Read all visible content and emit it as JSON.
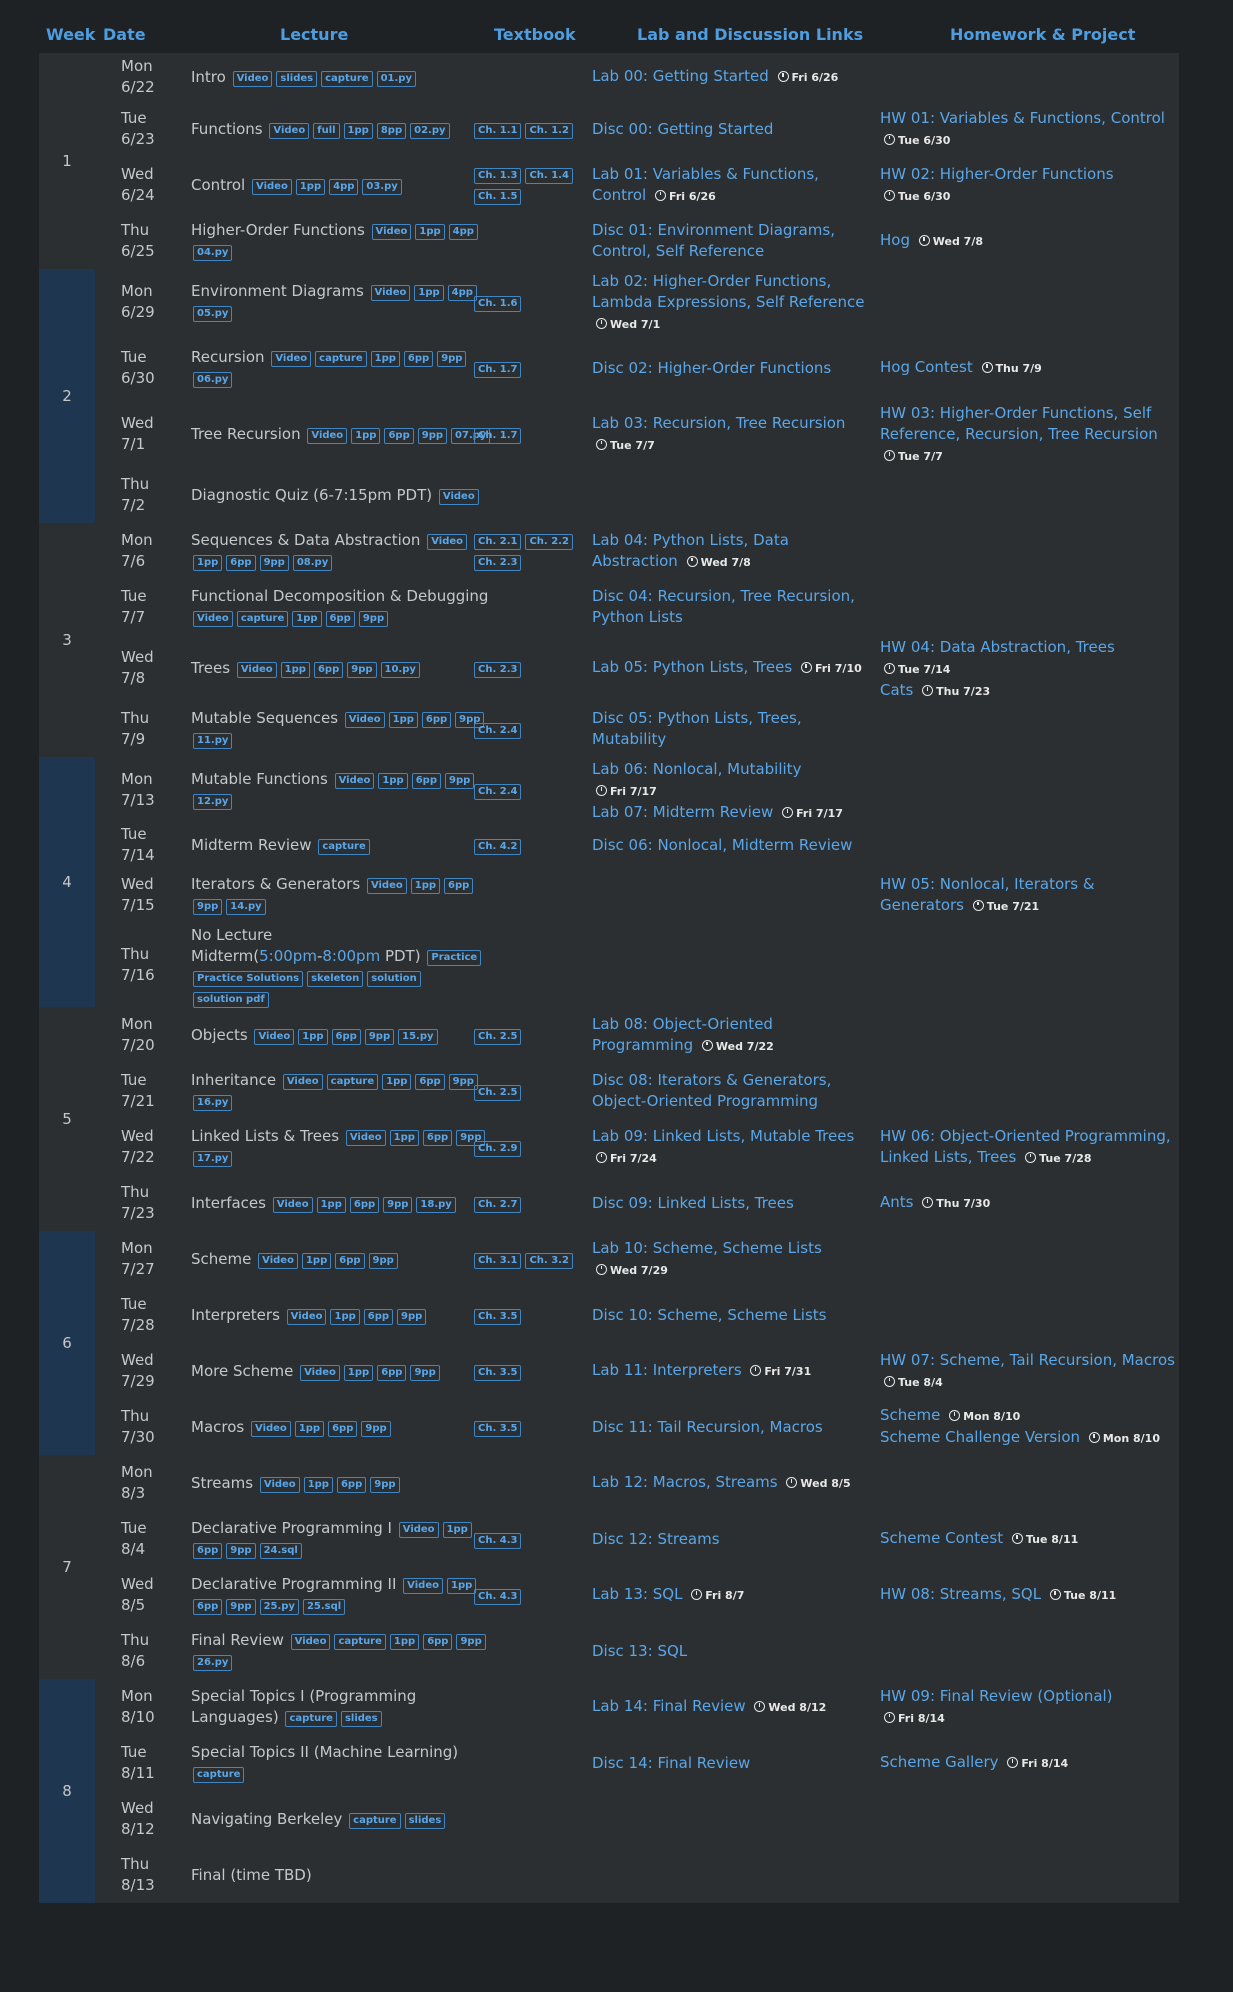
{
  "headers": {
    "week": "Week",
    "date": "Date",
    "lecture": "Lecture",
    "textbook": "Textbook",
    "labs": "Lab and Discussion Links",
    "homework": "Homework & Project"
  },
  "weeks": [
    {
      "label": "1"
    },
    {
      "label": "2"
    },
    {
      "label": "3"
    },
    {
      "label": "4"
    },
    {
      "label": "5"
    },
    {
      "label": "6"
    },
    {
      "label": "7"
    },
    {
      "label": "8"
    }
  ],
  "rows": [
    {
      "date": [
        "Mon",
        "6/22"
      ],
      "lecture": "Intro",
      "tags": [
        "Video",
        "slides",
        "capture",
        "01.py"
      ],
      "textbook": [],
      "labs": [
        {
          "text": "Lab 00: Getting Started",
          "due": "Fri 6/26"
        }
      ],
      "hw": []
    },
    {
      "date": [
        "Tue",
        "6/23"
      ],
      "lecture": "Functions",
      "tags": [
        "Video",
        "full",
        "1pp",
        "8pp",
        "02.py"
      ],
      "textbook": [
        "Ch. 1.1",
        "Ch. 1.2"
      ],
      "labs": [
        {
          "text": "Disc 00: Getting Started"
        }
      ],
      "hw": [
        {
          "text": "HW 01: Variables & Functions, Control",
          "due": "Tue 6/30"
        }
      ]
    },
    {
      "date": [
        "Wed",
        "6/24"
      ],
      "lecture": "Control",
      "tags": [
        "Video",
        "1pp",
        "4pp",
        "03.py"
      ],
      "textbook": [
        "Ch. 1.3",
        "Ch. 1.4",
        "Ch. 1.5"
      ],
      "labs": [
        {
          "text": "Lab 01: Variables & Functions, Control",
          "due": "Fri 6/26"
        }
      ],
      "hw": [
        {
          "text": "HW 02: Higher-Order Functions",
          "due": "Tue 6/30"
        }
      ]
    },
    {
      "date": [
        "Thu",
        "6/25"
      ],
      "lecture": "Higher-Order Functions",
      "tags": [
        "Video",
        "1pp",
        "4pp",
        "04.py"
      ],
      "textbook": [],
      "labs": [
        {
          "text": "Disc 01: Environment Diagrams, Control, Self Reference"
        }
      ],
      "hw": [
        {
          "text": "Hog",
          "due": "Wed 7/8"
        }
      ]
    },
    {
      "date": [
        "Mon",
        "6/29"
      ],
      "lecture": "Environment Diagrams",
      "tags": [
        "Video",
        "1pp",
        "4pp",
        "05.py"
      ],
      "textbook": [
        "Ch. 1.6"
      ],
      "labs": [
        {
          "text": "Lab 02: Higher-Order Functions, Lambda Expressions, Self Reference",
          "due": "Wed 7/1"
        }
      ],
      "hw": []
    },
    {
      "date": [
        "Tue",
        "6/30"
      ],
      "lecture": "Recursion",
      "tags": [
        "Video",
        "capture",
        "1pp",
        "6pp",
        "9pp",
        "06.py"
      ],
      "textbook": [
        "Ch. 1.7"
      ],
      "labs": [
        {
          "text": "Disc 02: Higher-Order Functions"
        }
      ],
      "hw": [
        {
          "text": "Hog Contest",
          "due": "Thu 7/9"
        }
      ]
    },
    {
      "date": [
        "Wed",
        "7/1"
      ],
      "lecture": "Tree Recursion",
      "tags": [
        "Video",
        "1pp",
        "6pp",
        "9pp",
        "07.py"
      ],
      "textbook": [
        "Ch. 1.7"
      ],
      "labs": [
        {
          "text": "Lab 03: Recursion, Tree Recursion",
          "due": "Tue 7/7"
        }
      ],
      "hw": [
        {
          "text": "HW 03: Higher-Order Functions, Self Reference, Recursion, Tree Recursion",
          "due": "Tue 7/7"
        }
      ]
    },
    {
      "date": [
        "Thu",
        "7/2"
      ],
      "lecture": "Diagnostic Quiz (6-7:15pm PDT)",
      "tags": [
        "Video"
      ],
      "textbook": [],
      "labs": [],
      "hw": []
    },
    {
      "date": [
        "Mon",
        "7/6"
      ],
      "lecture": "Sequences & Data Abstraction",
      "tags": [
        "Video",
        "1pp",
        "6pp",
        "9pp",
        "08.py"
      ],
      "textbook": [
        "Ch. 2.1",
        "Ch. 2.2",
        "Ch. 2.3"
      ],
      "labs": [
        {
          "text": "Lab 04: Python Lists, Data Abstraction",
          "due": "Wed 7/8"
        }
      ],
      "hw": []
    },
    {
      "date": [
        "Tue",
        "7/7"
      ],
      "lecture": "Functional Decomposition & Debugging",
      "tags": [
        "Video",
        "capture",
        "1pp",
        "6pp",
        "9pp"
      ],
      "textbook": [],
      "labs": [
        {
          "text": "Disc 04: Recursion, Tree Recursion, Python Lists"
        }
      ],
      "hw": []
    },
    {
      "date": [
        "Wed",
        "7/8"
      ],
      "lecture": "Trees",
      "tags": [
        "Video",
        "1pp",
        "6pp",
        "9pp",
        "10.py"
      ],
      "textbook": [
        "Ch. 2.3"
      ],
      "labs": [
        {
          "text": "Lab 05: Python Lists, Trees",
          "due": "Fri 7/10"
        }
      ],
      "hw": [
        {
          "text": "HW 04: Data Abstraction, Trees",
          "due": "Tue 7/14"
        },
        {
          "text": "Cats",
          "due": "Thu 7/23"
        }
      ]
    },
    {
      "date": [
        "Thu",
        "7/9"
      ],
      "lecture": "Mutable Sequences",
      "tags": [
        "Video",
        "1pp",
        "6pp",
        "9pp",
        "11.py"
      ],
      "textbook": [
        "Ch. 2.4"
      ],
      "labs": [
        {
          "text": "Disc 05: Python Lists, Trees, Mutability"
        }
      ],
      "hw": []
    },
    {
      "date": [
        "Mon",
        "7/13"
      ],
      "lecture": "Mutable Functions",
      "tags": [
        "Video",
        "1pp",
        "6pp",
        "9pp",
        "12.py"
      ],
      "textbook": [
        "Ch. 2.4"
      ],
      "labs": [
        {
          "text": "Lab 06: Nonlocal, Mutability",
          "due": "Fri 7/17"
        },
        {
          "text": "Lab 07: Midterm Review",
          "due": "Fri 7/17"
        }
      ],
      "hw": []
    },
    {
      "date": [
        "Tue",
        "7/14"
      ],
      "lecture": "Midterm Review",
      "tags": [
        "capture"
      ],
      "textbook": [
        "Ch. 4.2"
      ],
      "labs": [
        {
          "text": "Disc 06: Nonlocal, Midterm Review"
        }
      ],
      "hw": []
    },
    {
      "date": [
        "Wed",
        "7/15"
      ],
      "lecture": "Iterators & Generators",
      "tags": [
        "Video",
        "1pp",
        "6pp",
        "9pp",
        "14.py"
      ],
      "textbook": [],
      "labs": [],
      "hw": [
        {
          "text": "HW 05: Nonlocal, Iterators & Generators",
          "due": "Tue 7/21"
        }
      ]
    },
    {
      "date": [
        "Thu",
        "7/16"
      ],
      "lecture": "No Lecture",
      "midterm": {
        "prefix": "Midterm(",
        "start": "5:00pm",
        "sep": "-",
        "end": "8:00pm",
        "suffix": " PDT)"
      },
      "tags": [
        "Practice",
        "Practice Solutions",
        "skeleton",
        "solution",
        "solution pdf"
      ],
      "textbook": [],
      "labs": [],
      "hw": []
    },
    {
      "date": [
        "Mon",
        "7/20"
      ],
      "lecture": "Objects",
      "tags": [
        "Video",
        "1pp",
        "6pp",
        "9pp",
        "15.py"
      ],
      "textbook": [
        "Ch. 2.5"
      ],
      "labs": [
        {
          "text": "Lab 08: Object-Oriented Programming",
          "due": "Wed 7/22"
        }
      ],
      "hw": []
    },
    {
      "date": [
        "Tue",
        "7/21"
      ],
      "lecture": "Inheritance",
      "tags": [
        "Video",
        "capture",
        "1pp",
        "6pp",
        "9pp",
        "16.py"
      ],
      "textbook": [
        "Ch. 2.5"
      ],
      "labs": [
        {
          "text": "Disc 08: Iterators & Generators, Object-Oriented Programming"
        }
      ],
      "hw": []
    },
    {
      "date": [
        "Wed",
        "7/22"
      ],
      "lecture": "Linked Lists & Trees",
      "tags": [
        "Video",
        "1pp",
        "6pp",
        "9pp",
        "17.py"
      ],
      "textbook": [
        "Ch. 2.9"
      ],
      "labs": [
        {
          "text": "Lab 09: Linked Lists, Mutable Trees",
          "due": "Fri 7/24"
        }
      ],
      "hw": [
        {
          "text": "HW 06: Object-Oriented Programming, Linked Lists, Trees",
          "due": "Tue 7/28"
        }
      ]
    },
    {
      "date": [
        "Thu",
        "7/23"
      ],
      "lecture": "Interfaces",
      "tags": [
        "Video",
        "1pp",
        "6pp",
        "9pp",
        "18.py"
      ],
      "textbook": [
        "Ch. 2.7"
      ],
      "labs": [
        {
          "text": "Disc 09: Linked Lists, Trees"
        }
      ],
      "hw": [
        {
          "text": "Ants",
          "due": "Thu 7/30"
        }
      ]
    },
    {
      "date": [
        "Mon",
        "7/27"
      ],
      "lecture": "Scheme",
      "tags": [
        "Video",
        "1pp",
        "6pp",
        "9pp"
      ],
      "textbook": [
        "Ch. 3.1",
        "Ch. 3.2"
      ],
      "labs": [
        {
          "text": "Lab 10: Scheme, Scheme Lists",
          "due": "Wed 7/29"
        }
      ],
      "hw": []
    },
    {
      "date": [
        "Tue",
        "7/28"
      ],
      "lecture": "Interpreters",
      "tags": [
        "Video",
        "1pp",
        "6pp",
        "9pp"
      ],
      "textbook": [
        "Ch. 3.5"
      ],
      "labs": [
        {
          "text": "Disc 10: Scheme, Scheme Lists"
        }
      ],
      "hw": []
    },
    {
      "date": [
        "Wed",
        "7/29"
      ],
      "lecture": "More Scheme",
      "tags": [
        "Video",
        "1pp",
        "6pp",
        "9pp"
      ],
      "textbook": [
        "Ch. 3.5"
      ],
      "labs": [
        {
          "text": "Lab 11: Interpreters",
          "due": "Fri 7/31"
        }
      ],
      "hw": [
        {
          "text": "HW 07: Scheme, Tail Recursion, Macros",
          "due": "Tue 8/4"
        }
      ]
    },
    {
      "date": [
        "Thu",
        "7/30"
      ],
      "lecture": "Macros",
      "tags": [
        "Video",
        "1pp",
        "6pp",
        "9pp"
      ],
      "textbook": [
        "Ch. 3.5"
      ],
      "labs": [
        {
          "text": "Disc 11: Tail Recursion, Macros"
        }
      ],
      "hw": [
        {
          "text": "Scheme",
          "due": "Mon 8/10"
        },
        {
          "text": "Scheme Challenge Version",
          "due": "Mon 8/10"
        }
      ]
    },
    {
      "date": [
        "Mon",
        "8/3"
      ],
      "lecture": "Streams",
      "tags": [
        "Video",
        "1pp",
        "6pp",
        "9pp"
      ],
      "textbook": [],
      "labs": [
        {
          "text": "Lab 12: Macros, Streams",
          "due": "Wed 8/5"
        }
      ],
      "hw": []
    },
    {
      "date": [
        "Tue",
        "8/4"
      ],
      "lecture": "Declarative Programming I",
      "tags": [
        "Video",
        "1pp",
        "6pp",
        "9pp",
        "24.sql"
      ],
      "textbook": [
        "Ch. 4.3"
      ],
      "labs": [
        {
          "text": "Disc 12: Streams"
        }
      ],
      "hw": [
        {
          "text": "Scheme Contest",
          "due": "Tue 8/11"
        }
      ]
    },
    {
      "date": [
        "Wed",
        "8/5"
      ],
      "lecture": "Declarative Programming II",
      "tags": [
        "Video",
        "1pp",
        "6pp",
        "9pp",
        "25.py",
        "25.sql"
      ],
      "textbook": [
        "Ch. 4.3"
      ],
      "labs": [
        {
          "text": "Lab 13: SQL",
          "due": "Fri 8/7"
        }
      ],
      "hw": [
        {
          "text": "HW 08: Streams, SQL",
          "due": "Tue 8/11"
        }
      ]
    },
    {
      "date": [
        "Thu",
        "8/6"
      ],
      "lecture": "Final Review",
      "tags": [
        "Video",
        "capture",
        "1pp",
        "6pp",
        "9pp",
        "26.py"
      ],
      "textbook": [],
      "labs": [
        {
          "text": "Disc 13: SQL"
        }
      ],
      "hw": []
    },
    {
      "date": [
        "Mon",
        "8/10"
      ],
      "lecture": "Special Topics I (Programming Languages)",
      "tags": [
        "capture",
        "slides"
      ],
      "textbook": [],
      "labs": [
        {
          "text": "Lab 14: Final Review",
          "due": "Wed 8/12"
        }
      ],
      "hw": [
        {
          "text": "HW 09: Final Review (Optional)",
          "due": "Fri 8/14"
        }
      ]
    },
    {
      "date": [
        "Tue",
        "8/11"
      ],
      "lecture": "Special Topics II (Machine Learning)",
      "tags": [
        "capture"
      ],
      "textbook": [],
      "labs": [
        {
          "text": "Disc 14: Final Review"
        }
      ],
      "hw": [
        {
          "text": "Scheme Gallery",
          "due": "Fri 8/14"
        }
      ]
    },
    {
      "date": [
        "Wed",
        "8/12"
      ],
      "lecture": "Navigating Berkeley",
      "tags": [
        "capture",
        "slides"
      ],
      "textbook": [],
      "labs": [],
      "hw": []
    },
    {
      "date": [
        "Thu",
        "8/13"
      ],
      "lecture": "Final (time TBD)",
      "tags": [],
      "textbook": [],
      "labs": [],
      "hw": []
    }
  ]
}
